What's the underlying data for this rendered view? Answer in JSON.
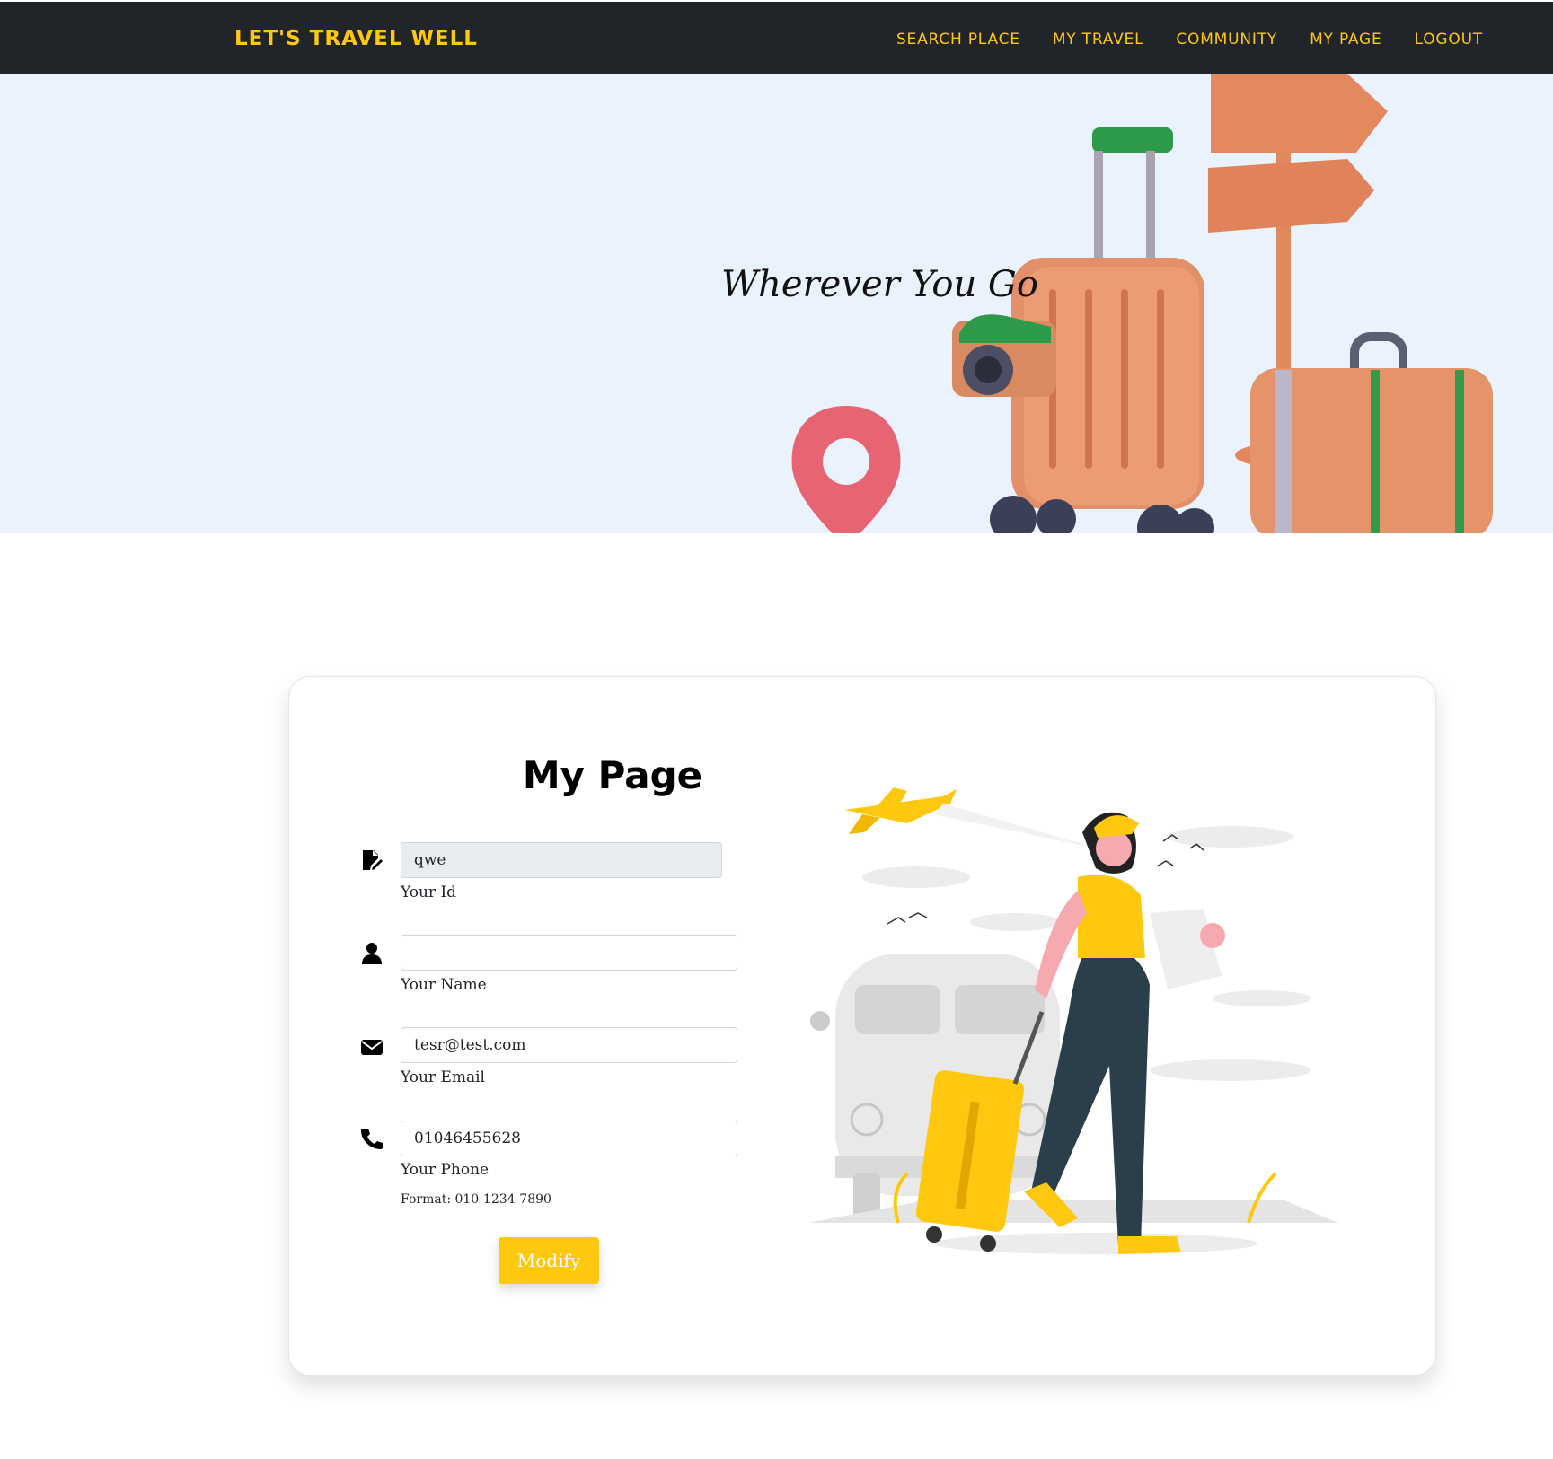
{
  "navbar": {
    "brand": "LET'S TRAVEL WELL",
    "links": [
      "SEARCH PLACE",
      "MY TRAVEL",
      "COMMUNITY",
      "MY PAGE",
      "LOGOUT"
    ]
  },
  "hero": {
    "title": "Wherever You Go"
  },
  "form": {
    "title": "My Page",
    "id": {
      "value": "qwe",
      "label": "Your Id",
      "icon": "user-edit-icon"
    },
    "name": {
      "value": "",
      "label": "Your Name",
      "icon": "user-icon"
    },
    "email": {
      "value": "tesr@test.com",
      "label": "Your Email",
      "icon": "envelope-icon"
    },
    "phone": {
      "value": "01046455628",
      "label": "Your Phone",
      "icon": "phone-icon",
      "hint": "Format: 010-1234-7890"
    },
    "submit_label": "Modify"
  },
  "colors": {
    "accent": "#fec810",
    "navbar_bg": "#212529",
    "hero_bg": "#e9f2fd"
  }
}
